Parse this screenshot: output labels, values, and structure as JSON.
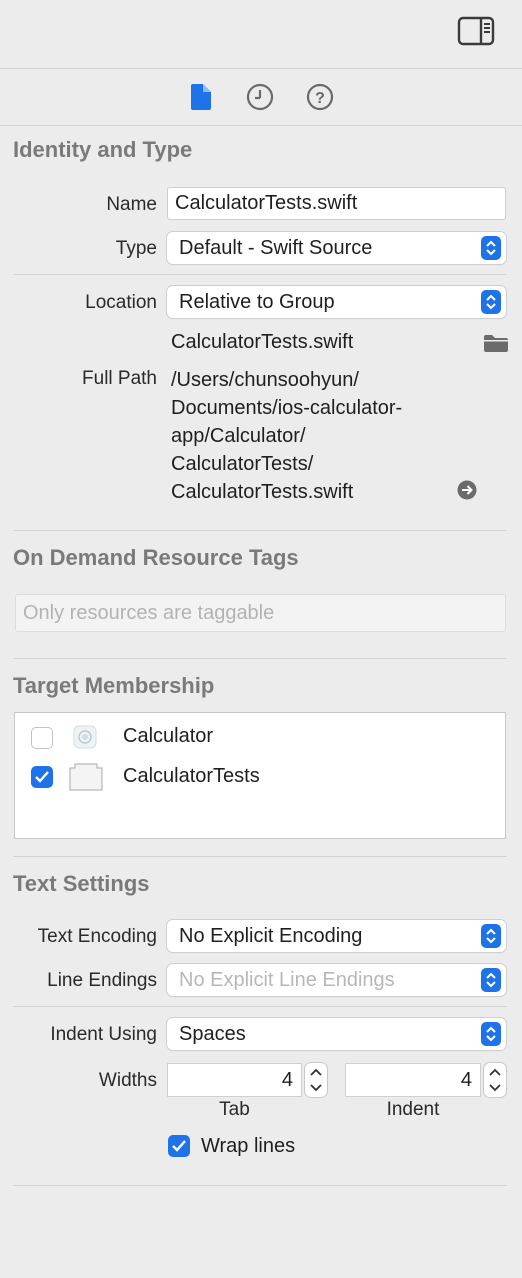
{
  "identity": {
    "section_title": "Identity and Type",
    "name_label": "Name",
    "name_value": "CalculatorTests.swift",
    "type_label": "Type",
    "type_value": "Default - Swift Source",
    "location_label": "Location",
    "location_value": "Relative to Group",
    "file_name": "CalculatorTests.swift",
    "full_path_label": "Full Path",
    "full_path_lines": [
      "/Users/chunsoohyun/",
      "Documents/ios-calculator-",
      "app/Calculator/",
      "CalculatorTests/",
      "CalculatorTests.swift"
    ]
  },
  "on_demand": {
    "section_title": "On Demand Resource Tags",
    "placeholder": "Only resources are taggable"
  },
  "target_membership": {
    "section_title": "Target Membership",
    "targets": [
      {
        "name": "Calculator",
        "checked": false
      },
      {
        "name": "CalculatorTests",
        "checked": true
      }
    ]
  },
  "text_settings": {
    "section_title": "Text Settings",
    "encoding_label": "Text Encoding",
    "encoding_value": "No Explicit Encoding",
    "line_endings_label": "Line Endings",
    "line_endings_value": "No Explicit Line Endings",
    "indent_label": "Indent Using",
    "indent_value": "Spaces",
    "widths_label": "Widths",
    "tab_value": "4",
    "tab_label": "Tab",
    "indent_width_value": "4",
    "indent_width_label": "Indent",
    "wrap_lines_label": "Wrap lines",
    "wrap_lines_checked": true
  },
  "colors": {
    "accent": "#1f73e8",
    "background": "#ececec",
    "section_title": "#7a7a7a"
  },
  "icons": {
    "inspector_tabs": [
      "file-icon",
      "history-icon",
      "help-icon"
    ],
    "top_right": "sidebar-toggle-icon"
  }
}
